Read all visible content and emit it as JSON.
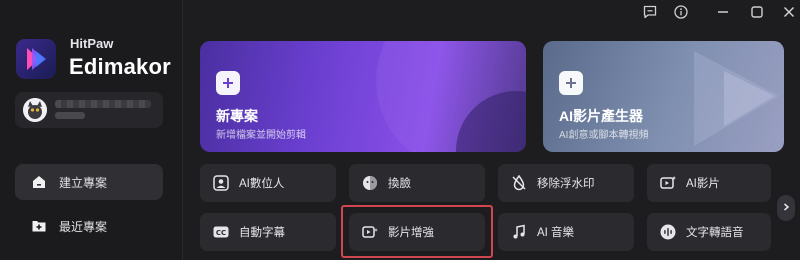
{
  "brand": {
    "small": "HitPaw",
    "big": "Edimakor"
  },
  "sidebar": {
    "items": [
      {
        "label": "建立專案",
        "icon": "home-icon",
        "active": true
      },
      {
        "label": "最近專案",
        "icon": "folder-plus-icon",
        "active": false
      }
    ]
  },
  "window_controls": [
    "feedback-icon",
    "info-icon",
    "minimize-icon",
    "maximize-icon",
    "close-icon"
  ],
  "hero": [
    {
      "title": "新專案",
      "subtitle": "新增檔案並開始剪輯",
      "icon": "plus-icon"
    },
    {
      "title": "AI影片產生器",
      "subtitle": "AI創意或腳本轉視頻",
      "icon": "plus-icon"
    }
  ],
  "tools": {
    "row1": [
      {
        "label": "AI數位人",
        "icon": "avatar-frame-icon"
      },
      {
        "label": "換臉",
        "icon": "face-swap-icon"
      },
      {
        "label": "移除浮水印",
        "icon": "remove-watermark-icon"
      },
      {
        "label": "AI影片",
        "icon": "ai-video-icon"
      }
    ],
    "row2": [
      {
        "label": "自動字幕",
        "icon": "cc-icon"
      },
      {
        "label": "影片增強",
        "icon": "video-enhance-icon"
      },
      {
        "label": "AI 音樂",
        "icon": "music-icon"
      },
      {
        "label": "文字轉語音",
        "icon": "voice-wave-icon"
      }
    ]
  },
  "colors": {
    "accent_highlight": "#d0474f",
    "hero_purple": "#7a48e0"
  }
}
